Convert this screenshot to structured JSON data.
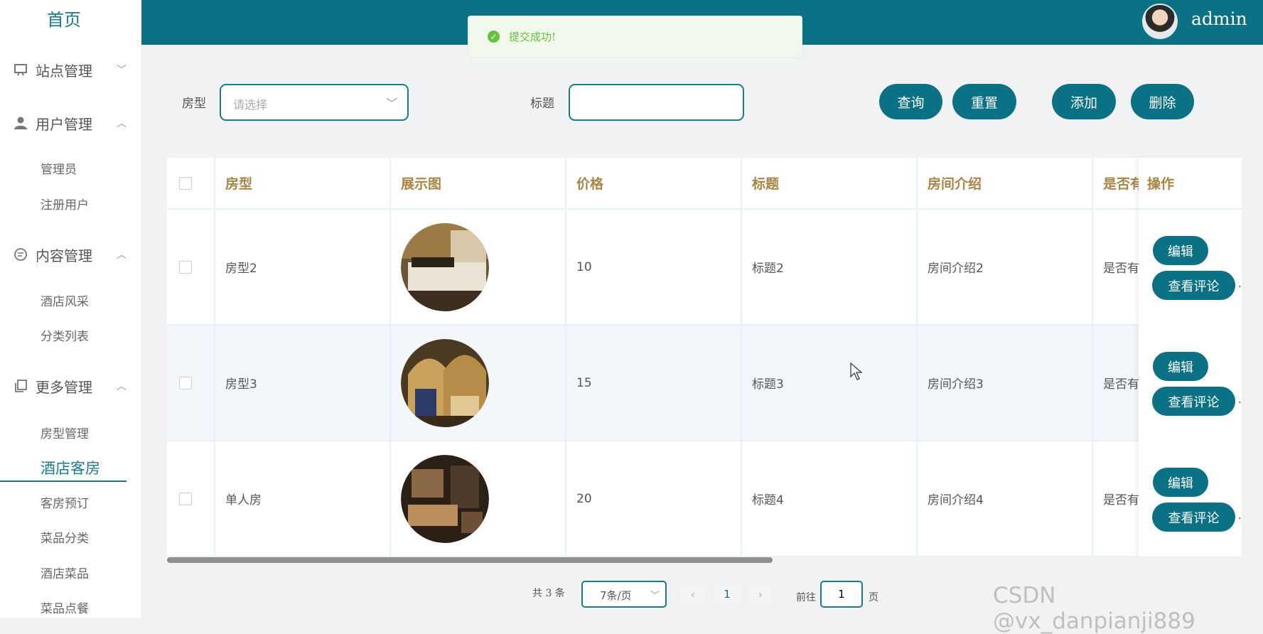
{
  "sidebar": {
    "brand": "首页",
    "groups": [
      {
        "label": "站点管理",
        "icon": "monitor-icon",
        "caret": "﹀",
        "items": []
      },
      {
        "label": "用户管理",
        "icon": "user-icon",
        "caret": "︿",
        "items": [
          "管理员",
          "注册用户"
        ]
      },
      {
        "label": "内容管理",
        "icon": "chat-icon",
        "caret": "︿",
        "items": [
          "酒店风采",
          "分类列表"
        ]
      },
      {
        "label": "更多管理",
        "icon": "copy-icon",
        "caret": "︿",
        "items": [
          "房型管理",
          "酒店客房",
          "客房预订",
          "菜品分类",
          "酒店菜品",
          "菜品点餐"
        ]
      }
    ],
    "active_item": "酒店客房"
  },
  "header": {
    "username": "admin"
  },
  "toast": {
    "message": "提交成功!",
    "type": "success"
  },
  "search": {
    "roomtype_label": "房型",
    "roomtype_placeholder": "请选择",
    "title_label": "标题",
    "title_value": "",
    "query_label": "查询",
    "reset_label": "重置",
    "add_label": "添加",
    "delete_label": "删除"
  },
  "table": {
    "columns": [
      "房型",
      "展示图",
      "价格",
      "标题",
      "房间介绍",
      "是否有",
      "操作"
    ],
    "rows": [
      {
        "roomtype": "房型2",
        "price": "10",
        "title": "标题2",
        "intro": "房间介绍2",
        "flag": "是否有",
        "edit": "编辑",
        "comment": "查看评论"
      },
      {
        "roomtype": "房型3",
        "price": "15",
        "title": "标题3",
        "intro": "房间介绍3",
        "flag": "是否有",
        "edit": "编辑",
        "comment": "查看评论"
      },
      {
        "roomtype": "单人房",
        "price": "20",
        "title": "标题4",
        "intro": "房间介绍4",
        "flag": "是否有",
        "edit": "编辑",
        "comment": "查看评论"
      }
    ]
  },
  "pagination": {
    "total": "共 3 条",
    "page_size": "7条/页",
    "current_page": "1",
    "goto_label": "前往",
    "goto_value": "1",
    "goto_suffix": "页"
  },
  "watermark": "CSDN @vx_danpianji889",
  "colors": {
    "primary": "#0b7285",
    "header_text": "#a88445",
    "success": "#67c23a"
  }
}
